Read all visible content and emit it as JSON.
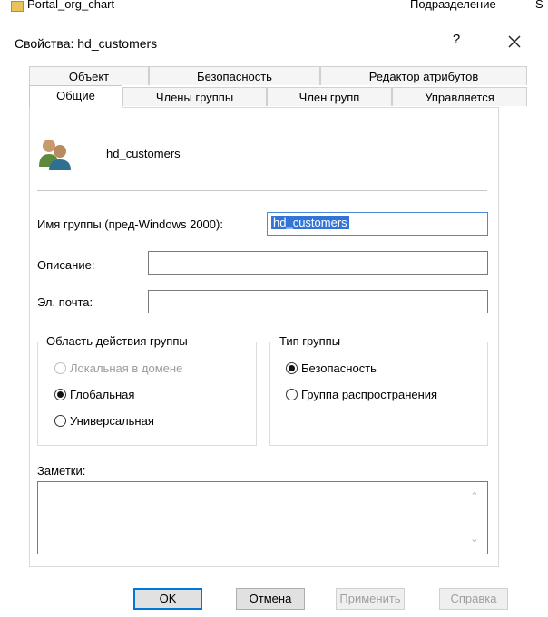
{
  "background": {
    "item_name": "Portal_org_chart",
    "column_header": "Подразделение",
    "column_header2": "S"
  },
  "dialog": {
    "title": "Свойства: hd_customers",
    "help_glyph": "?",
    "close_glyph": "✕"
  },
  "tabs": {
    "top": [
      "Объект",
      "Безопасность",
      "Редактор атрибутов"
    ],
    "bottom": [
      "Общие",
      "Члены группы",
      "Член групп",
      "Управляется"
    ],
    "active": "Общие"
  },
  "general": {
    "group_name": "hd_customers",
    "pre2000_label": "Имя группы (пред-Windows 2000):",
    "pre2000_value": "hd_customers",
    "description_label": "Описание:",
    "description_value": "",
    "email_label": "Эл. почта:",
    "email_value": ""
  },
  "scope": {
    "title": "Область действия группы",
    "options": [
      "Локальная в домене",
      "Глобальная",
      "Универсальная"
    ],
    "selected": "Глобальная",
    "disabled": [
      "Локальная в домене"
    ]
  },
  "type": {
    "title": "Тип группы",
    "options": [
      "Безопасность",
      "Группа распространения"
    ],
    "selected": "Безопасность"
  },
  "notes": {
    "label": "Заметки:",
    "value": ""
  },
  "buttons": {
    "ok": "OK",
    "cancel": "Отмена",
    "apply": "Применить",
    "help": "Справка"
  },
  "colors": {
    "selection": "#3375d6",
    "default_button_border": "#0078d7",
    "disabled_text": "#9c9c9c"
  }
}
